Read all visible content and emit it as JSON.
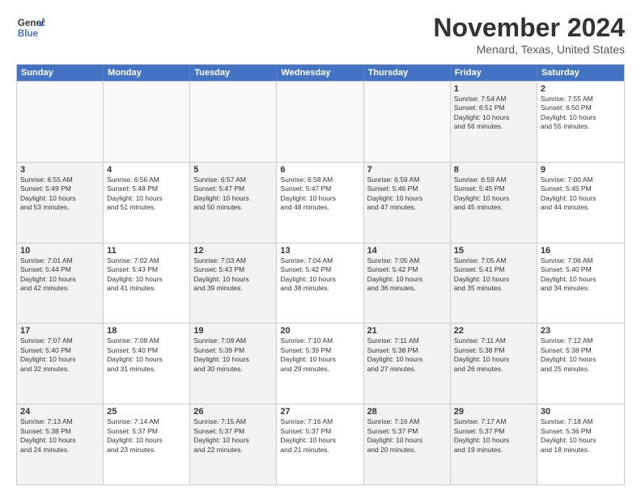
{
  "header": {
    "logo_line1": "General",
    "logo_line2": "Blue",
    "month": "November 2024",
    "location": "Menard, Texas, United States"
  },
  "weekdays": [
    "Sunday",
    "Monday",
    "Tuesday",
    "Wednesday",
    "Thursday",
    "Friday",
    "Saturday"
  ],
  "rows": [
    [
      {
        "day": "",
        "info": "",
        "empty": true
      },
      {
        "day": "",
        "info": "",
        "empty": true
      },
      {
        "day": "",
        "info": "",
        "empty": true
      },
      {
        "day": "",
        "info": "",
        "empty": true
      },
      {
        "day": "",
        "info": "",
        "empty": true
      },
      {
        "day": "1",
        "info": "Sunrise: 7:54 AM\nSunset: 6:51 PM\nDaylight: 10 hours\nand 56 minutes.",
        "shaded": true
      },
      {
        "day": "2",
        "info": "Sunrise: 7:55 AM\nSunset: 6:50 PM\nDaylight: 10 hours\nand 55 minutes."
      }
    ],
    [
      {
        "day": "3",
        "info": "Sunrise: 6:55 AM\nSunset: 5:49 PM\nDaylight: 10 hours\nand 53 minutes.",
        "shaded": true
      },
      {
        "day": "4",
        "info": "Sunrise: 6:56 AM\nSunset: 5:48 PM\nDaylight: 10 hours\nand 51 minutes."
      },
      {
        "day": "5",
        "info": "Sunrise: 6:57 AM\nSunset: 5:47 PM\nDaylight: 10 hours\nand 50 minutes.",
        "shaded": true
      },
      {
        "day": "6",
        "info": "Sunrise: 6:58 AM\nSunset: 5:47 PM\nDaylight: 10 hours\nand 48 minutes."
      },
      {
        "day": "7",
        "info": "Sunrise: 6:59 AM\nSunset: 5:46 PM\nDaylight: 10 hours\nand 47 minutes.",
        "shaded": true
      },
      {
        "day": "8",
        "info": "Sunrise: 6:59 AM\nSunset: 5:45 PM\nDaylight: 10 hours\nand 45 minutes.",
        "shaded": true
      },
      {
        "day": "9",
        "info": "Sunrise: 7:00 AM\nSunset: 5:45 PM\nDaylight: 10 hours\nand 44 minutes."
      }
    ],
    [
      {
        "day": "10",
        "info": "Sunrise: 7:01 AM\nSunset: 5:44 PM\nDaylight: 10 hours\nand 42 minutes.",
        "shaded": true
      },
      {
        "day": "11",
        "info": "Sunrise: 7:02 AM\nSunset: 5:43 PM\nDaylight: 10 hours\nand 41 minutes."
      },
      {
        "day": "12",
        "info": "Sunrise: 7:03 AM\nSunset: 5:43 PM\nDaylight: 10 hours\nand 39 minutes.",
        "shaded": true
      },
      {
        "day": "13",
        "info": "Sunrise: 7:04 AM\nSunset: 5:42 PM\nDaylight: 10 hours\nand 38 minutes."
      },
      {
        "day": "14",
        "info": "Sunrise: 7:05 AM\nSunset: 5:42 PM\nDaylight: 10 hours\nand 36 minutes.",
        "shaded": true
      },
      {
        "day": "15",
        "info": "Sunrise: 7:05 AM\nSunset: 5:41 PM\nDaylight: 10 hours\nand 35 minutes.",
        "shaded": true
      },
      {
        "day": "16",
        "info": "Sunrise: 7:06 AM\nSunset: 5:40 PM\nDaylight: 10 hours\nand 34 minutes."
      }
    ],
    [
      {
        "day": "17",
        "info": "Sunrise: 7:07 AM\nSunset: 5:40 PM\nDaylight: 10 hours\nand 32 minutes.",
        "shaded": true
      },
      {
        "day": "18",
        "info": "Sunrise: 7:08 AM\nSunset: 5:40 PM\nDaylight: 10 hours\nand 31 minutes."
      },
      {
        "day": "19",
        "info": "Sunrise: 7:09 AM\nSunset: 5:39 PM\nDaylight: 10 hours\nand 30 minutes.",
        "shaded": true
      },
      {
        "day": "20",
        "info": "Sunrise: 7:10 AM\nSunset: 5:39 PM\nDaylight: 10 hours\nand 29 minutes."
      },
      {
        "day": "21",
        "info": "Sunrise: 7:11 AM\nSunset: 5:38 PM\nDaylight: 10 hours\nand 27 minutes.",
        "shaded": true
      },
      {
        "day": "22",
        "info": "Sunrise: 7:11 AM\nSunset: 5:38 PM\nDaylight: 10 hours\nand 26 minutes.",
        "shaded": true
      },
      {
        "day": "23",
        "info": "Sunrise: 7:12 AM\nSunset: 5:38 PM\nDaylight: 10 hours\nand 25 minutes."
      }
    ],
    [
      {
        "day": "24",
        "info": "Sunrise: 7:13 AM\nSunset: 5:38 PM\nDaylight: 10 hours\nand 24 minutes.",
        "shaded": true
      },
      {
        "day": "25",
        "info": "Sunrise: 7:14 AM\nSunset: 5:37 PM\nDaylight: 10 hours\nand 23 minutes."
      },
      {
        "day": "26",
        "info": "Sunrise: 7:15 AM\nSunset: 5:37 PM\nDaylight: 10 hours\nand 22 minutes.",
        "shaded": true
      },
      {
        "day": "27",
        "info": "Sunrise: 7:16 AM\nSunset: 5:37 PM\nDaylight: 10 hours\nand 21 minutes."
      },
      {
        "day": "28",
        "info": "Sunrise: 7:16 AM\nSunset: 5:37 PM\nDaylight: 10 hours\nand 20 minutes.",
        "shaded": true
      },
      {
        "day": "29",
        "info": "Sunrise: 7:17 AM\nSunset: 5:37 PM\nDaylight: 10 hours\nand 19 minutes.",
        "shaded": true
      },
      {
        "day": "30",
        "info": "Sunrise: 7:18 AM\nSunset: 5:36 PM\nDaylight: 10 hours\nand 18 minutes."
      }
    ]
  ]
}
